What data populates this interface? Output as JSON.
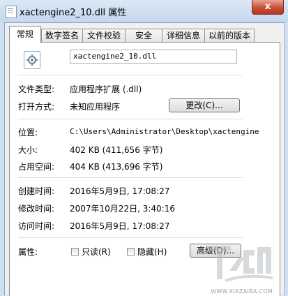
{
  "window": {
    "title": "xactengine2_10.dll 属性",
    "close_glyph": "x"
  },
  "tabs": [
    {
      "label": "常规",
      "active": true
    },
    {
      "label": "数字签名"
    },
    {
      "label": "文件校验"
    },
    {
      "label": "安全"
    },
    {
      "label": "详细信息"
    },
    {
      "label": "以前的版本"
    }
  ],
  "general": {
    "file_name": "xactengine2_10.dll",
    "file_type_label": "文件类型:",
    "file_type_value": "应用程序扩展 (.dll)",
    "opens_with_label": "打开方式:",
    "opens_with_value": "未知应用程序",
    "change_button": "更改(C)...",
    "location_label": "位置:",
    "location_value": "C:\\Users\\Administrator\\Desktop\\xactengine",
    "size_label": "大小:",
    "size_value": "402 KB (411,656 字节)",
    "size_on_disk_label": "占用空间:",
    "size_on_disk_value": "404 KB (413,696 字节)",
    "created_label": "创建时间:",
    "created_value": "2016年5月9日, 17:08:27",
    "modified_label": "修改时间:",
    "modified_value": "2007年10月22日, 3:40:16",
    "accessed_label": "访问时间:",
    "accessed_value": "2016年5月9日, 17:08:27",
    "attributes_label": "属性:",
    "readonly_label": "只读(R)",
    "readonly_checked": false,
    "hidden_label": "隐藏(H)",
    "hidden_checked": false,
    "advanced_button": "高级(D)..."
  },
  "watermark": {
    "url_text": "WWW.XIAZAIBA.COM"
  },
  "colors": {
    "titlebar": "#c4d8ee",
    "close_button": "#c7503a",
    "panel": "#ffffff",
    "dialog": "#f0f0f0"
  }
}
